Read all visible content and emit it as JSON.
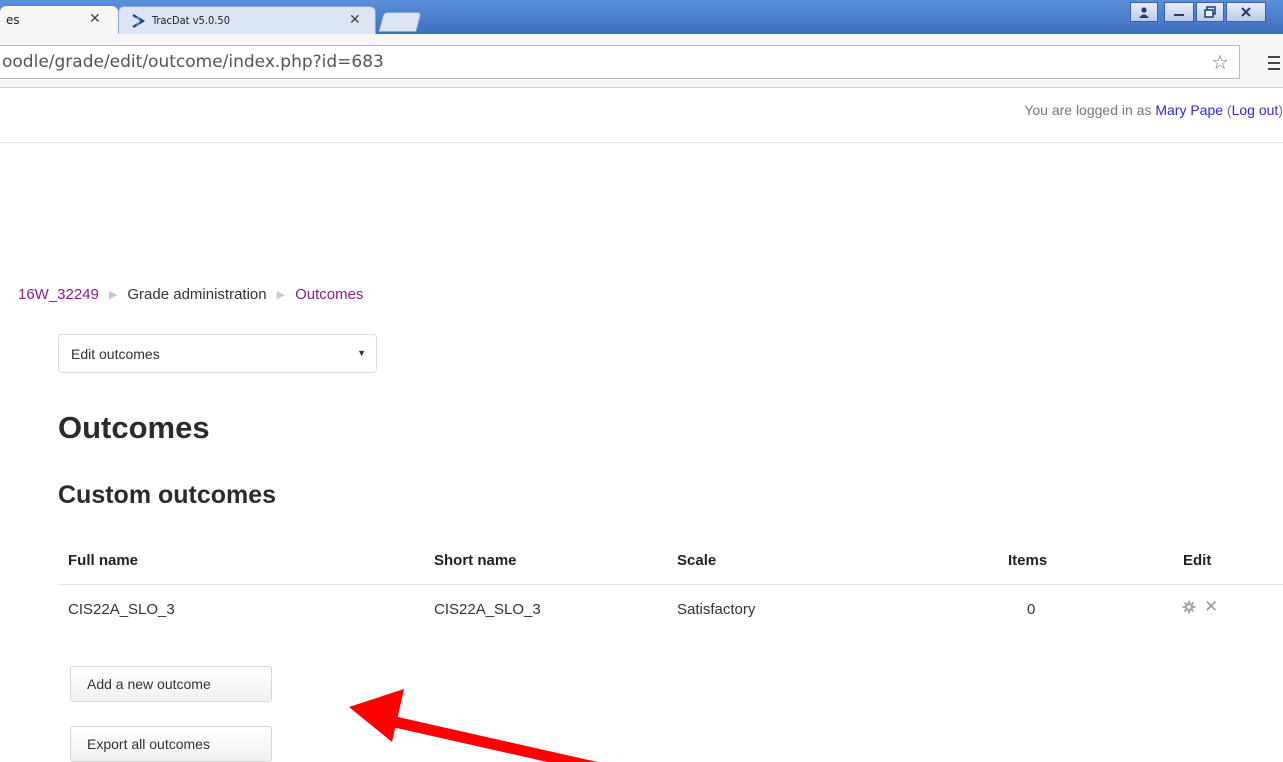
{
  "browser": {
    "tabs": [
      {
        "title": "es",
        "active": true
      },
      {
        "title": "TracDat v5.0.50",
        "active": false
      }
    ],
    "close_glyph": "✕",
    "url": "oodle/grade/edit/outcome/index.php?id=683",
    "window_buttons": [
      "user-icon",
      "minimize-icon",
      "restore-icon",
      "close-icon"
    ]
  },
  "userbar": {
    "prefix": "You are logged in as ",
    "user_name": "Mary Pape",
    "open_paren": " (",
    "logout": "Log out",
    "close_paren": ")"
  },
  "breadcrumb": [
    {
      "label": "16W_32249",
      "link": true
    },
    {
      "label": "Grade administration",
      "link": false
    },
    {
      "label": "Outcomes",
      "link": true
    }
  ],
  "breadcrumb_separator": "▶",
  "select": {
    "value": "Edit outcomes"
  },
  "headings": {
    "h1": "Outcomes",
    "h2": "Custom outcomes"
  },
  "table": {
    "headers": {
      "full_name": "Full name",
      "short_name": "Short name",
      "scale": "Scale",
      "items": "Items",
      "edit": "Edit"
    },
    "rows": [
      {
        "full_name": "CIS22A_SLO_3",
        "short_name": "CIS22A_SLO_3",
        "scale": "Satisfactory",
        "items": "0"
      }
    ]
  },
  "buttons": {
    "add": "Add a new outcome",
    "export": "Export all outcomes"
  },
  "colors": {
    "link": "#2a2adb",
    "visited_link": "#8a1e8a",
    "annotation_arrow": "#ff0000",
    "tabstrip": "#4a7cd0"
  }
}
